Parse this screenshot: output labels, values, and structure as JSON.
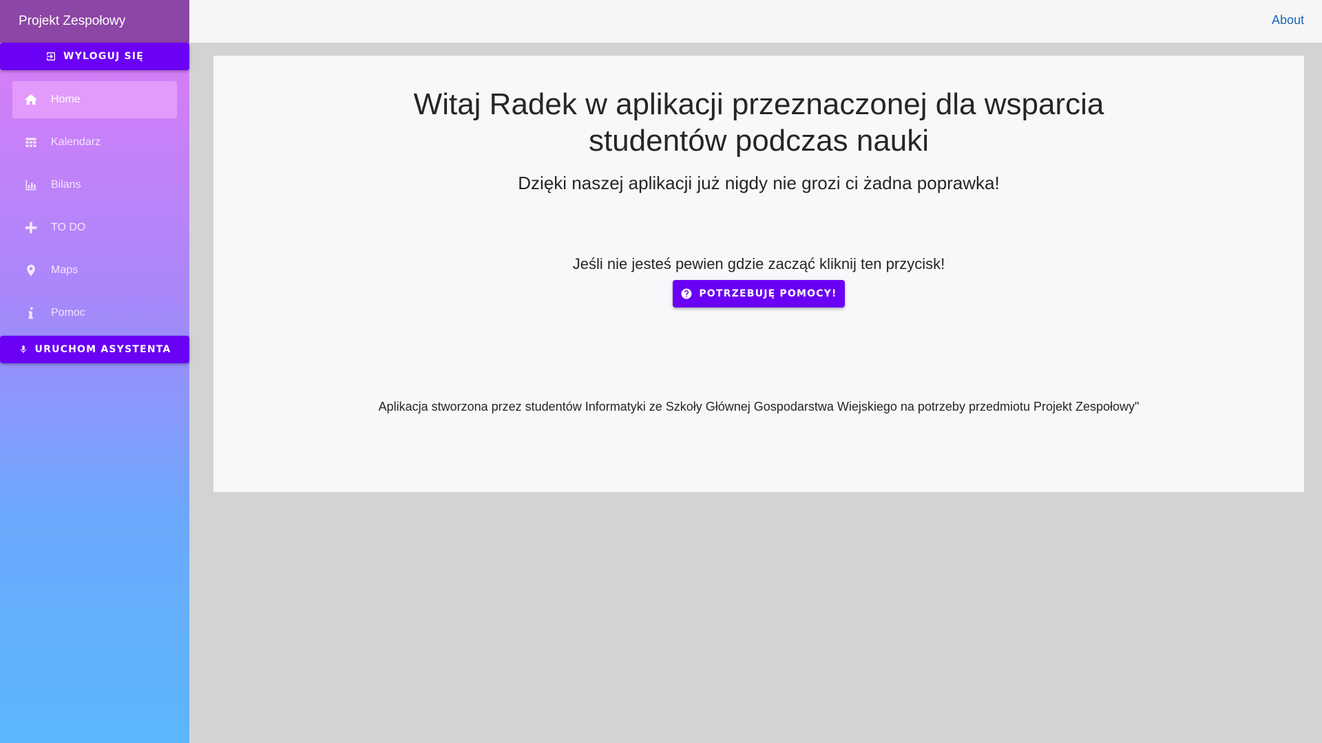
{
  "sidebar": {
    "brand": "Projekt Zespołowy",
    "logout_label": "WYLOGUJ SIĘ",
    "items": [
      {
        "label": "Home",
        "icon": "home-icon",
        "active": true
      },
      {
        "label": "Kalendarz",
        "icon": "calendar-icon"
      },
      {
        "label": "Bilans",
        "icon": "bar-chart-icon"
      },
      {
        "label": "TO DO",
        "icon": "plus-icon"
      },
      {
        "label": "Maps",
        "icon": "map-pin-icon"
      },
      {
        "label": "Pomoc",
        "icon": "info-icon"
      }
    ],
    "assistant_label": "URUCHOM ASYSTENTA"
  },
  "topbar": {
    "about_label": "About"
  },
  "main": {
    "headline": "Witaj Radek w aplikacji przeznaczonej dla wsparcia studentów podczas nauki",
    "subheadline": "Dzięki naszej aplikacji już nigdy nie grozi ci żadna poprawka!",
    "prompt": "Jeśli nie jesteś pewien gdzie zacząć kliknij ten przycisk!",
    "help_button_label": "POTRZEBUJĘ POMOCY!",
    "footer": "Aplikacja stworzona przez studentów Informatyki ze Szkoły Głównej Gospodarstwa Wiejskiego na potrzeby przedmiotu Projekt Zespołowy\""
  },
  "colors": {
    "accent": "#6a00f4",
    "brand_bar": "#8c46a5",
    "link": "#1a66b8",
    "active_nav": "#e29bfa"
  }
}
